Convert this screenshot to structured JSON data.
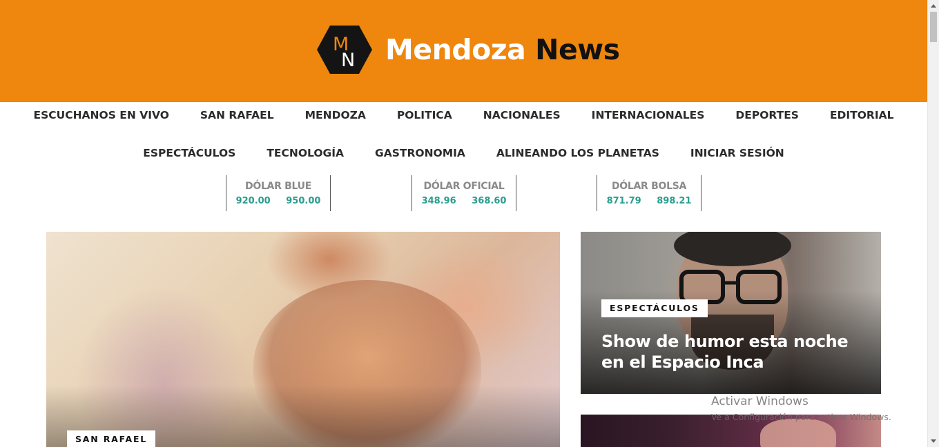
{
  "header": {
    "logo_letters": "MN",
    "brand_word_1": "Mendoza",
    "brand_word_2": "News",
    "colors": {
      "background": "#ef860d",
      "brand_white": "#ffffff",
      "brand_dark": "#111111"
    }
  },
  "nav": {
    "row1": [
      "ESCUCHANOS EN VIVO",
      "SAN RAFAEL",
      "MENDOZA",
      "POLITICA",
      "NACIONALES",
      "INTERNACIONALES",
      "DEPORTES",
      "EDITORIAL"
    ],
    "row2": [
      "ESPECTÁCULOS",
      "TECNOLOGÍA",
      "GASTRONOMIA",
      "ALINEANDO LOS PLANETAS",
      "INICIAR SESIÓN"
    ]
  },
  "currency": [
    {
      "title": "DÓLAR BLUE",
      "buy": "920.00",
      "sell": "950.00"
    },
    {
      "title": "DÓLAR OFICIAL",
      "buy": "348.96",
      "sell": "368.60"
    },
    {
      "title": "DÓLAR BOLSA",
      "buy": "871.79",
      "sell": "898.21"
    }
  ],
  "featured": {
    "main": {
      "category": "SAN RAFAEL"
    },
    "side1": {
      "category": "ESPECTÁCULOS",
      "title": "Show de humor esta noche en el Espacio Inca"
    }
  },
  "watermark": {
    "line1": "Activar Windows",
    "line2": "Ve a Configuración para activar Windows."
  },
  "accent_colors": {
    "currency_value": "#2a9d8f",
    "nav_text": "#2b2b2b"
  }
}
